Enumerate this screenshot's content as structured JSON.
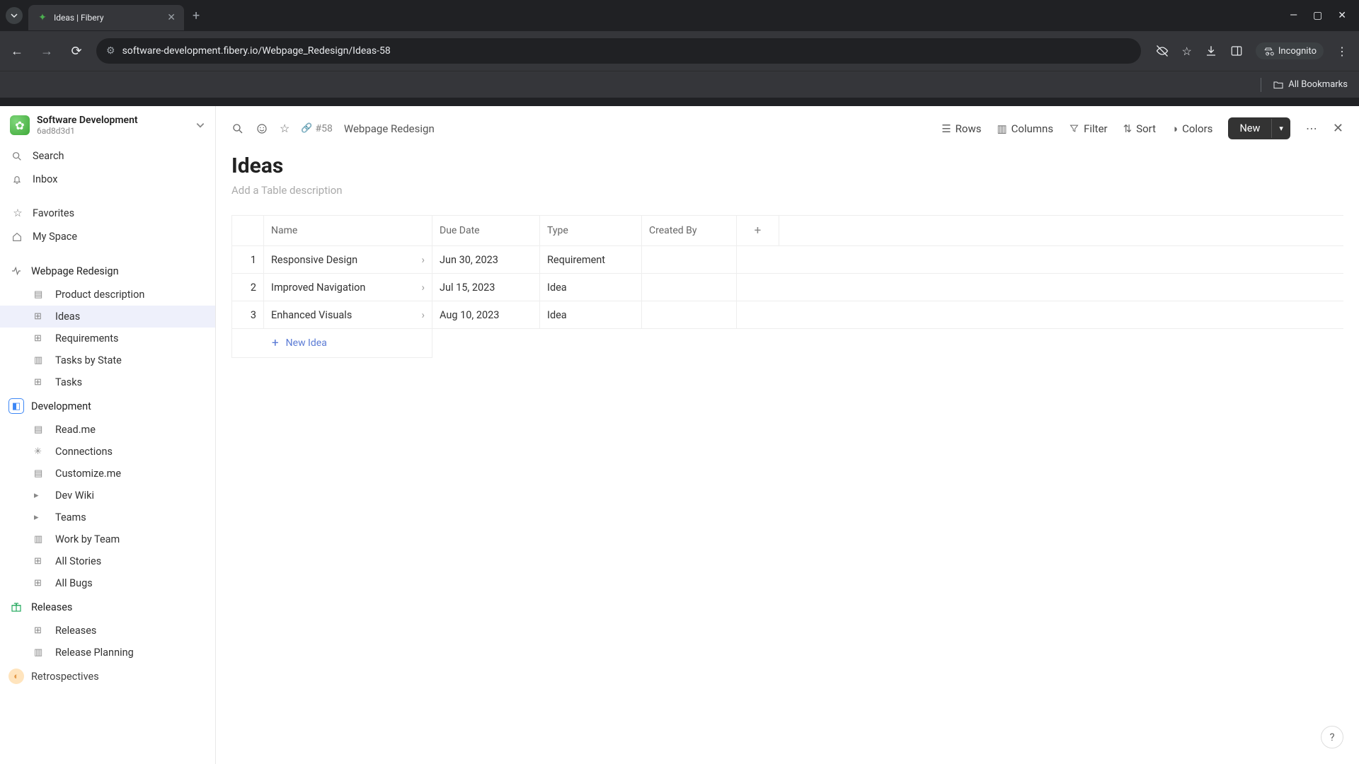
{
  "browser": {
    "tab_title": "Ideas | Fibery",
    "url": "software-development.fibery.io/Webpage_Redesign/Ideas-58",
    "incognito_label": "Incognito",
    "all_bookmarks": "All Bookmarks"
  },
  "workspace": {
    "name": "Software Development",
    "id": "6ad8d3d1"
  },
  "sidebar": {
    "search": "Search",
    "inbox": "Inbox",
    "favorites": "Favorites",
    "my_space": "My Space",
    "spaces": [
      {
        "name": "Webpage Redesign",
        "items": [
          "Product description",
          "Ideas",
          "Requirements",
          "Tasks by State",
          "Tasks"
        ],
        "active_index": 1
      },
      {
        "name": "Development",
        "items": [
          "Read.me",
          "Connections",
          "Customize.me",
          "Dev Wiki",
          "Teams",
          "Work by Team",
          "All Stories",
          "All Bugs"
        ]
      },
      {
        "name": "Releases",
        "items": [
          "Releases",
          "Release Planning"
        ]
      },
      {
        "name": "Retrospectives",
        "items": []
      }
    ]
  },
  "topbar": {
    "entity_id": "#58",
    "entity_name": "Webpage Redesign",
    "rows": "Rows",
    "columns": "Columns",
    "filter": "Filter",
    "sort": "Sort",
    "colors": "Colors",
    "new": "New"
  },
  "page": {
    "title": "Ideas",
    "description_placeholder": "Add a Table description"
  },
  "table": {
    "columns": [
      "Name",
      "Due Date",
      "Type",
      "Created By"
    ],
    "rows": [
      {
        "num": "1",
        "name": "Responsive Design",
        "due": "Jun 30, 2023",
        "type": "Requirement",
        "created_by": ""
      },
      {
        "num": "2",
        "name": "Improved Navigation",
        "due": "Jul 15, 2023",
        "type": "Idea",
        "created_by": ""
      },
      {
        "num": "3",
        "name": "Enhanced Visuals",
        "due": "Aug 10, 2023",
        "type": "Idea",
        "created_by": ""
      }
    ],
    "new_row_label": "New Idea"
  }
}
